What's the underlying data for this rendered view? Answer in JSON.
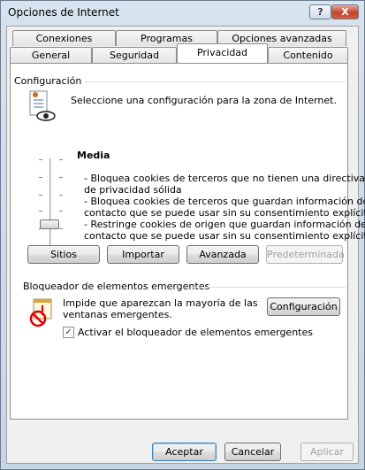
{
  "window": {
    "title": "Opciones de Internet",
    "help_label": "?",
    "close_label": "X"
  },
  "tabs": [
    {
      "label": "Conexiones"
    },
    {
      "label": "Programas"
    },
    {
      "label": "Opciones avanzadas"
    },
    {
      "label": "General"
    },
    {
      "label": "Seguridad"
    },
    {
      "label": "Privacidad",
      "active": true
    },
    {
      "label": "Contenido"
    }
  ],
  "privacy": {
    "section_title": "Configuración",
    "zone_text": "Seleccione una configuración para la zona de Internet.",
    "level_name": "Media",
    "level_description_lines": [
      "- Bloquea cookies de terceros que no tienen una directiva",
      "de privacidad sólida",
      "- Bloquea cookies de terceros que guardan información de",
      "contacto que se puede usar sin su consentimiento explícito",
      "- Restringe cookies de origen que guardan información de",
      "contacto que se  puede usar sin su consentimiento explícito"
    ],
    "buttons": {
      "sites": "Sitios",
      "import": "Importar",
      "advanced": "Avanzada",
      "default": "Predeterminada"
    }
  },
  "popup": {
    "section_title": "Bloqueador de elementos emergentes",
    "description_lines": [
      "Impide que aparezcan la mayoría de las",
      "ventanas emergentes."
    ],
    "settings_button": "Configuración",
    "enable_checkbox_label": "Activar el bloqueador de elementos emergentes",
    "enable_checked": true,
    "checkmark": "✓"
  },
  "footer": {
    "ok": "Aceptar",
    "cancel": "Cancelar",
    "apply": "Aplicar"
  },
  "icons": {
    "privacy": "privacy-eye-icon",
    "popup_blocker": "popup-blocker-icon"
  },
  "colors": {
    "title_bar": "#d7e3ee",
    "close_button": "#c4442c",
    "group_line": "#d5dfe5"
  }
}
